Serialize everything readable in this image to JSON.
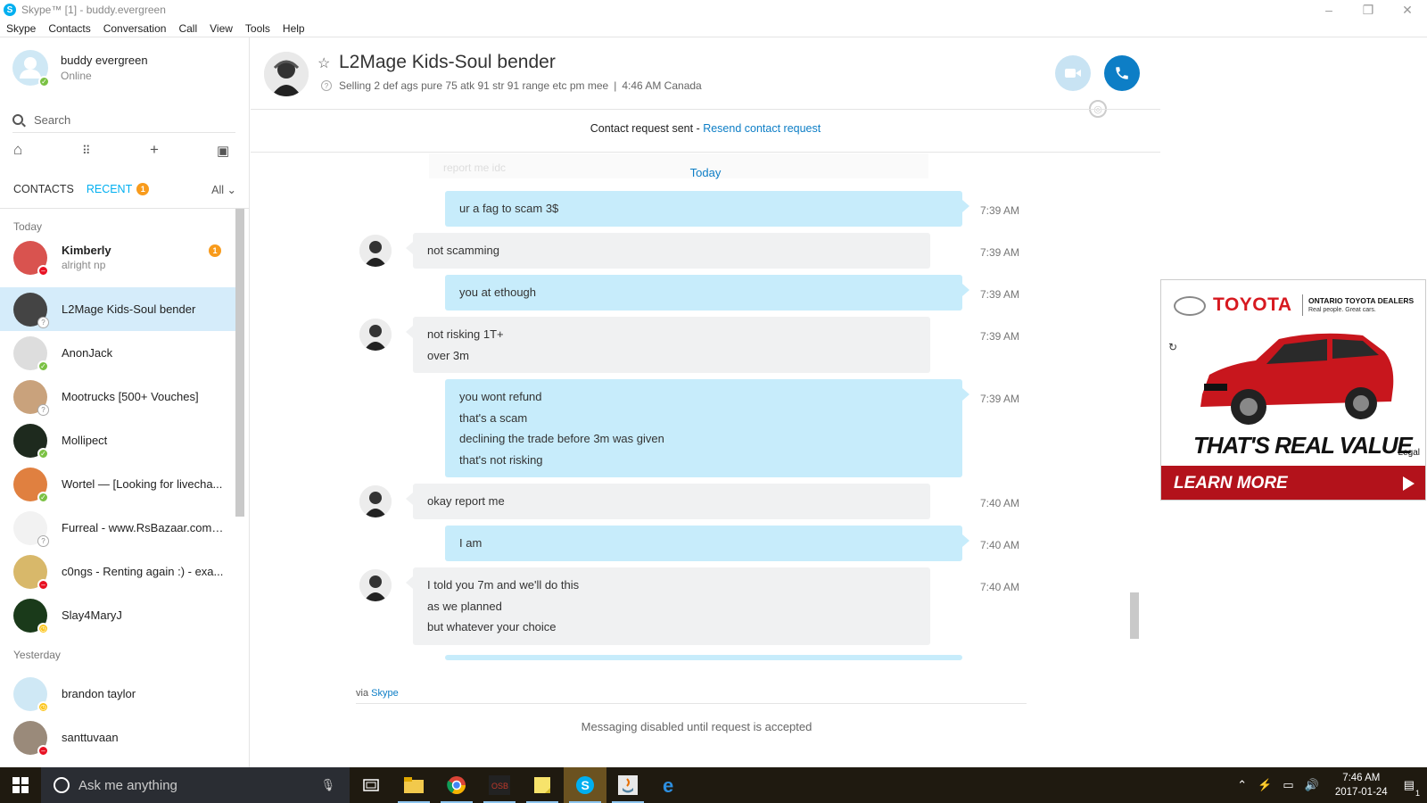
{
  "window": {
    "title": "Skype™ [1] - buddy.evergreen",
    "logo_letter": "S",
    "minimize": "–",
    "maximize": "❐",
    "close": "✕"
  },
  "menu": [
    "Skype",
    "Contacts",
    "Conversation",
    "Call",
    "View",
    "Tools",
    "Help"
  ],
  "profile": {
    "name": "buddy evergreen",
    "status": "Online"
  },
  "search": {
    "label": "Search"
  },
  "tabs": {
    "contacts": "CONTACTS",
    "recent": "RECENT",
    "recent_badge": "1",
    "filter": "All"
  },
  "sections": {
    "today": "Today",
    "yesterday": "Yesterday"
  },
  "contacts": [
    {
      "name": "Kimberly",
      "sub": "alright np",
      "badge": "1",
      "status": "dnd",
      "color": "#d9534f"
    },
    {
      "name": "L2Mage Kids-Soul bender",
      "sub": "",
      "status": "unknown",
      "color": "#444444"
    },
    {
      "name": "AnonJack",
      "sub": "",
      "status": "online",
      "color": "#dddddd"
    },
    {
      "name": "Mootrucks [500+ Vouches]",
      "sub": "",
      "status": "unknown",
      "color": "#c9a27c"
    },
    {
      "name": "Mollipect",
      "sub": "",
      "status": "online",
      "color": "#1e2a1e"
    },
    {
      "name": "Wortel — [Looking for livecha...",
      "sub": "",
      "status": "online",
      "color": "#e08040"
    },
    {
      "name": "Furreal - www.RsBazaar.com -...",
      "sub": "",
      "status": "unknown",
      "color": "#f2f2f2"
    },
    {
      "name": "c0ngs - Renting again :) - exa...",
      "sub": "",
      "status": "dnd",
      "color": "#d8b86a"
    },
    {
      "name": "Slay4MaryJ",
      "sub": "",
      "status": "away",
      "color": "#1a3a1a"
    },
    {
      "name": "brandon taylor",
      "sub": "",
      "status": "away",
      "color": "#cfe8f5"
    },
    {
      "name": "santtuvaan",
      "sub": "",
      "status": "dnd",
      "color": "#9a8a7a"
    }
  ],
  "conversation": {
    "name": "L2Mage Kids-Soul bender",
    "mood": "Selling 2 def ags pure 75 atk 91 str 91 range etc pm mee",
    "local_time": "4:46 AM Canada",
    "request_sent": "Contact request sent - ",
    "resend": "Resend contact request",
    "ghost_text": "report me idc",
    "today": "Today",
    "via_prefix": "via ",
    "via_link": "Skype",
    "disabled": "Messaging disabled until request is accepted"
  },
  "messages": [
    {
      "dir": "out",
      "lines": [
        "ur a fag to scam 3$"
      ],
      "time": "7:39 AM"
    },
    {
      "dir": "in",
      "lines": [
        "not scamming"
      ],
      "time": "7:39 AM"
    },
    {
      "dir": "out",
      "lines": [
        "you at ethough"
      ],
      "time": "7:39 AM"
    },
    {
      "dir": "in",
      "lines": [
        "not risking 1T+",
        "over 3m"
      ],
      "time": "7:39 AM"
    },
    {
      "dir": "out",
      "lines": [
        "you wont refund",
        "that's a scam",
        "declining the trade before 3m was given",
        "that's not risking"
      ],
      "time": "7:39 AM"
    },
    {
      "dir": "in",
      "lines": [
        "okay report me"
      ],
      "time": "7:40 AM"
    },
    {
      "dir": "out",
      "lines": [
        "I am"
      ],
      "time": "7:40 AM"
    },
    {
      "dir": "in",
      "lines": [
        "I told you 7m and we'll do this",
        "as we planned",
        "but whatever your choice"
      ],
      "time": "7:40 AM"
    }
  ],
  "ad": {
    "brand": "TOYOTA",
    "dealer": "ONTARIO TOYOTA DEALERS",
    "tag": "Real people. Great cars.",
    "tagline": "THAT'S REAL VALUE",
    "legal": "Legal",
    "cta": "LEARN MORE",
    "car_color": "#c8161d"
  },
  "taskbar": {
    "search_placeholder": "Ask me anything",
    "time": "7:46 AM",
    "date": "2017-01-24",
    "notification_count": "1"
  }
}
